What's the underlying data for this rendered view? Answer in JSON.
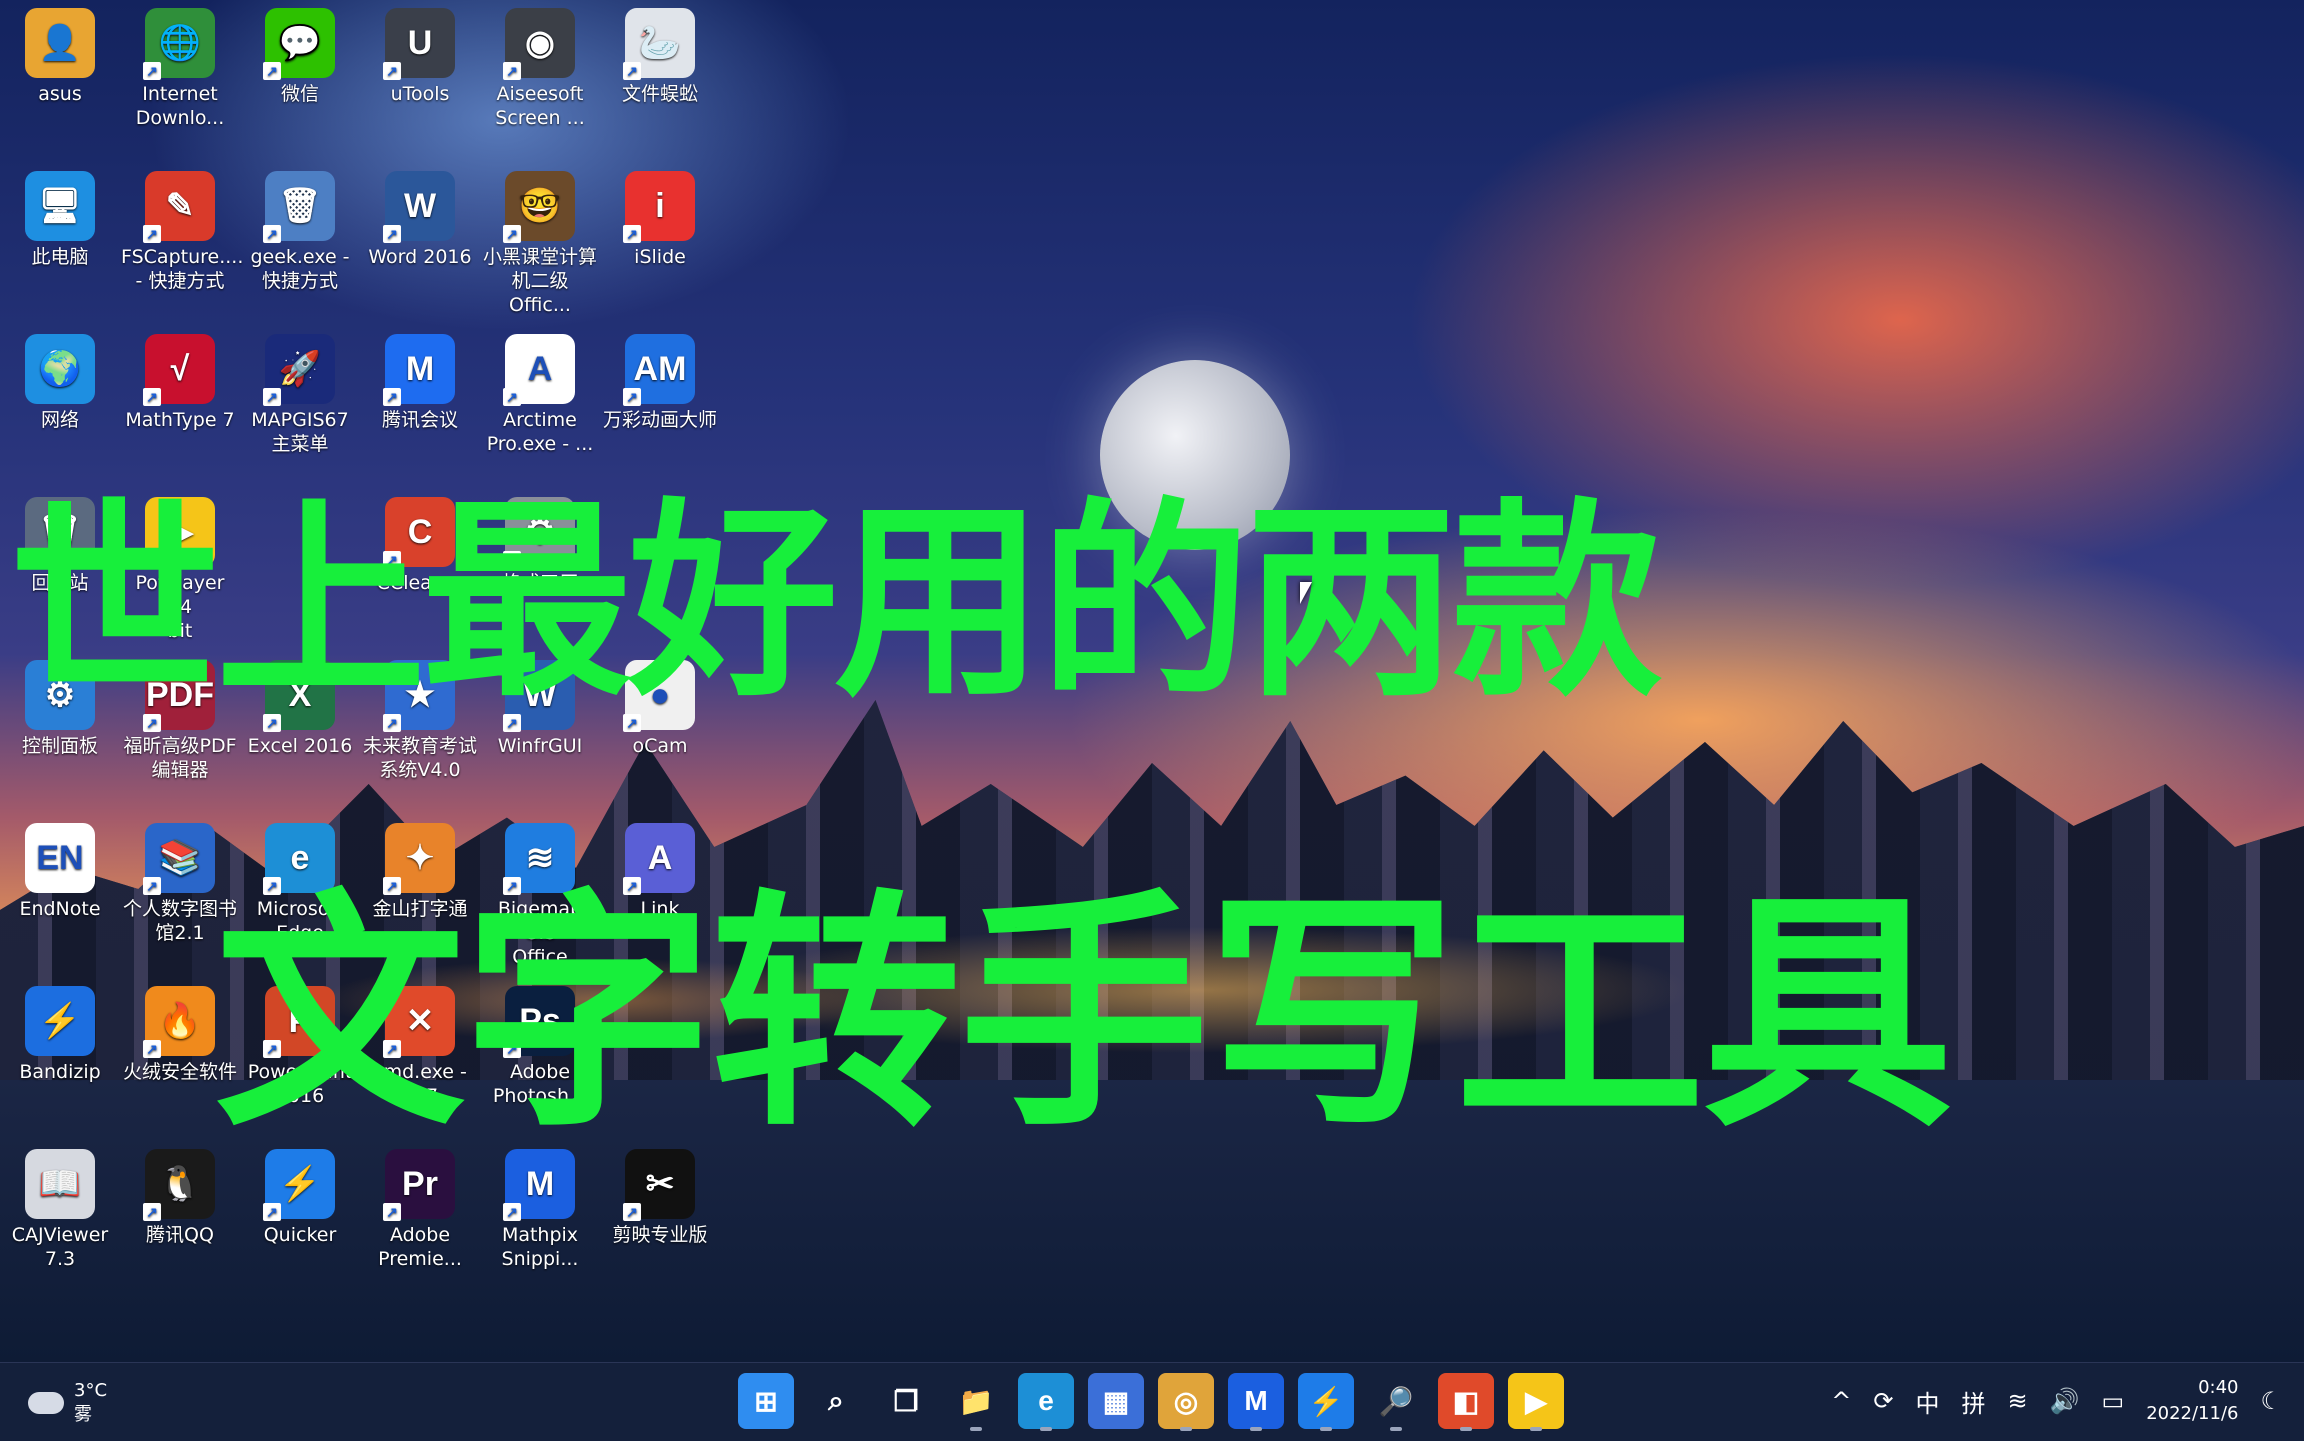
{
  "desktop": {
    "icons": [
      {
        "label": "asus",
        "icon": "folder-user-icon",
        "color": "#e8a532",
        "glyph": "👤",
        "shortcut": false
      },
      {
        "label": "Internet\nDownlo...",
        "icon": "idm-globe-icon",
        "color": "#2f8f3a",
        "glyph": "🌐",
        "shortcut": true
      },
      {
        "label": "微信",
        "icon": "wechat-icon",
        "color": "#2dc100",
        "glyph": "💬",
        "shortcut": true
      },
      {
        "label": "uTools",
        "icon": "utools-icon",
        "color": "#3a3f4a",
        "glyph": "U",
        "shortcut": true
      },
      {
        "label": "Aiseesoft\nScreen ...",
        "icon": "aiseesoft-recorder-icon",
        "color": "#3b3f47",
        "glyph": "◉",
        "shortcut": true
      },
      {
        "label": "文件蜈蚣",
        "icon": "goose-icon",
        "color": "#e0e4ea",
        "glyph": "🦢",
        "shortcut": true
      },
      {
        "label": "此电脑",
        "icon": "this-pc-icon",
        "color": "#1e8fe1",
        "glyph": "🖥",
        "shortcut": false
      },
      {
        "label": "FSCapture....\n- 快捷方式",
        "icon": "fscapture-icon",
        "color": "#d93a2a",
        "glyph": "✎",
        "shortcut": true
      },
      {
        "label": "geek.exe -\n快捷方式",
        "icon": "geek-uninstaller-icon",
        "color": "#4d7fc4",
        "glyph": "🗑",
        "shortcut": true
      },
      {
        "label": "Word 2016",
        "icon": "word-icon",
        "color": "#2b579a",
        "glyph": "W",
        "shortcut": true
      },
      {
        "label": "小黑课堂计算\n机二级Offic...",
        "icon": "xiaohei-avatar-icon",
        "color": "#6b4a2a",
        "glyph": "🤓",
        "shortcut": true
      },
      {
        "label": "iSlide",
        "icon": "islide-icon",
        "color": "#e8312f",
        "glyph": "i",
        "shortcut": true
      },
      {
        "label": "网络",
        "icon": "network-icon",
        "color": "#1e8fe1",
        "glyph": "🌍",
        "shortcut": false
      },
      {
        "label": "MathType 7",
        "icon": "mathtype-icon",
        "color": "#c8102e",
        "glyph": "√",
        "shortcut": true
      },
      {
        "label": "MAPGIS67\n主菜单",
        "icon": "mapgis-icon",
        "color": "#1a2a7a",
        "glyph": "🚀",
        "shortcut": true
      },
      {
        "label": "腾讯会议",
        "icon": "tencent-meeting-icon",
        "color": "#1e6cf0",
        "glyph": "M",
        "shortcut": true
      },
      {
        "label": "Arctime\nPro.exe - ...",
        "icon": "arctime-icon",
        "color": "#ffffff",
        "glyph": "A",
        "shortcut": true
      },
      {
        "label": "万彩动画大师",
        "icon": "wancai-icon",
        "color": "#1f6fe0",
        "glyph": "AM",
        "shortcut": true
      },
      {
        "label": "回收站",
        "icon": "recycle-bin-icon",
        "color": "#5b6a80",
        "glyph": "🗑",
        "shortcut": false
      },
      {
        "label": "PotPlayer 64\nbit",
        "icon": "potplayer-icon",
        "color": "#f5c518",
        "glyph": "▶",
        "shortcut": true
      },
      {
        "label": "",
        "icon": "spacer-icon",
        "color": "transparent",
        "glyph": "",
        "shortcut": false
      },
      {
        "label": "CCleaner",
        "icon": "ccleaner-icon",
        "color": "#d9412b",
        "glyph": "C",
        "shortcut": true
      },
      {
        "label": "格式工厂",
        "icon": "format-factory-icon",
        "color": "#8a8f99",
        "glyph": "⚙",
        "shortcut": true
      },
      {
        "label": "",
        "icon": "spacer-icon",
        "color": "transparent",
        "glyph": "",
        "shortcut": false
      },
      {
        "label": "控制面板",
        "icon": "control-panel-icon",
        "color": "#2a7fd6",
        "glyph": "⚙",
        "shortcut": false
      },
      {
        "label": "福昕高级PDF\n编辑器",
        "icon": "foxit-pdf-icon",
        "color": "#a0203a",
        "glyph": "PDF",
        "shortcut": true
      },
      {
        "label": "Excel 2016",
        "icon": "excel-icon",
        "color": "#217346",
        "glyph": "X",
        "shortcut": true
      },
      {
        "label": "未来教育考试\n系统V4.0",
        "icon": "exam-system-icon",
        "color": "#2f6bd1",
        "glyph": "★",
        "shortcut": true
      },
      {
        "label": "WinfrGUI",
        "icon": "winfrgui-icon",
        "color": "#2a5db0",
        "glyph": "W",
        "shortcut": true
      },
      {
        "label": "oCam",
        "icon": "ocam-icon",
        "color": "#f0f0f0",
        "glyph": "●",
        "shortcut": true
      },
      {
        "label": "EndNote",
        "icon": "endnote-icon",
        "color": "#ffffff",
        "glyph": "EN",
        "shortcut": false
      },
      {
        "label": "个人数字图书\n馆2.1",
        "icon": "digital-library-icon",
        "color": "#2a66c9",
        "glyph": "📚",
        "shortcut": true
      },
      {
        "label": "Microsoft\nEdge",
        "icon": "edge-icon",
        "color": "#1d8fd6",
        "glyph": "e",
        "shortcut": true
      },
      {
        "label": "金山打字通",
        "icon": "jinshan-typing-icon",
        "color": "#e8832a",
        "glyph": "✦",
        "shortcut": true
      },
      {
        "label": "Bigemap GIS\nOffice",
        "icon": "bigemap-icon",
        "color": "#1f7de0",
        "glyph": "≋",
        "shortcut": true
      },
      {
        "label": "Link",
        "icon": "link-app-icon",
        "color": "#5a5fd6",
        "glyph": "A",
        "shortcut": true
      },
      {
        "label": "Bandizip",
        "icon": "bandizip-icon",
        "color": "#1c6ee0",
        "glyph": "⚡",
        "shortcut": false
      },
      {
        "label": "火绒安全软件",
        "icon": "huorong-icon",
        "color": "#f08a1c",
        "glyph": "🔥",
        "shortcut": true
      },
      {
        "label": "PowerPoint\n2016",
        "icon": "powerpoint-icon",
        "color": "#d24726",
        "glyph": "P",
        "shortcut": true
      },
      {
        "label": "cmd.exe -\n007",
        "icon": "cmd-icon",
        "color": "#e04a2a",
        "glyph": "✕",
        "shortcut": true
      },
      {
        "label": "Adobe\nPhotosh...",
        "icon": "photoshop-icon",
        "color": "#0a1f3f",
        "glyph": "Ps",
        "shortcut": true
      },
      {
        "label": "",
        "icon": "spacer-icon",
        "color": "transparent",
        "glyph": "",
        "shortcut": false
      },
      {
        "label": "CAJViewer\n7.3",
        "icon": "cajviewer-icon",
        "color": "#d6d9e0",
        "glyph": "📖",
        "shortcut": false
      },
      {
        "label": "腾讯QQ",
        "icon": "qq-icon",
        "color": "#1a1a1a",
        "glyph": "🐧",
        "shortcut": true
      },
      {
        "label": "Quicker",
        "icon": "quicker-icon",
        "color": "#1e7ce8",
        "glyph": "⚡",
        "shortcut": true
      },
      {
        "label": "Adobe\nPremie...",
        "icon": "premiere-icon",
        "color": "#2a0f3f",
        "glyph": "Pr",
        "shortcut": true
      },
      {
        "label": "Mathpix\nSnippi...",
        "icon": "mathpix-icon",
        "color": "#1b5fe0",
        "glyph": "M",
        "shortcut": true
      },
      {
        "label": "剪映专业版",
        "icon": "jianying-icon",
        "color": "#111111",
        "glyph": "✂",
        "shortcut": true
      }
    ]
  },
  "overlay": {
    "line1": "世上最好用的两款",
    "line2": "文字转手写工具"
  },
  "taskbar": {
    "weather_temp": "3°C",
    "weather_desc": "雾",
    "apps": [
      {
        "name": "start-button",
        "glyph": "⊞",
        "color": "#2f8df0"
      },
      {
        "name": "search-icon",
        "glyph": "⌕",
        "color": "transparent"
      },
      {
        "name": "task-view-icon",
        "glyph": "❐",
        "color": "transparent"
      },
      {
        "name": "file-explorer-icon",
        "glyph": "📁",
        "color": "transparent"
      },
      {
        "name": "edge-taskbar-icon",
        "glyph": "e",
        "color": "#1d8fd6"
      },
      {
        "name": "store-icon",
        "glyph": "▦",
        "color": "#3b6fd8"
      },
      {
        "name": "chrome-icon",
        "glyph": "◎",
        "color": "#e0a43a"
      },
      {
        "name": "mathpix-taskbar-icon",
        "glyph": "M",
        "color": "#1b5fe0"
      },
      {
        "name": "quicker-taskbar-icon",
        "glyph": "⚡",
        "color": "#1e7ce8"
      },
      {
        "name": "magnifier-icon",
        "glyph": "🔎",
        "color": "transparent"
      },
      {
        "name": "office-icon",
        "glyph": "◧",
        "color": "#e04a2a"
      },
      {
        "name": "potplayer-taskbar-icon",
        "glyph": "▶",
        "color": "#f5c518"
      }
    ],
    "tray": {
      "chevron": "^",
      "sync": "⟳",
      "ime_lang": "中",
      "ime_mode": "拼",
      "wifi": "≋",
      "volume": "🔊",
      "battery": "▭",
      "time": "0:40",
      "date": "2022/11/6",
      "moon": "☾"
    }
  }
}
